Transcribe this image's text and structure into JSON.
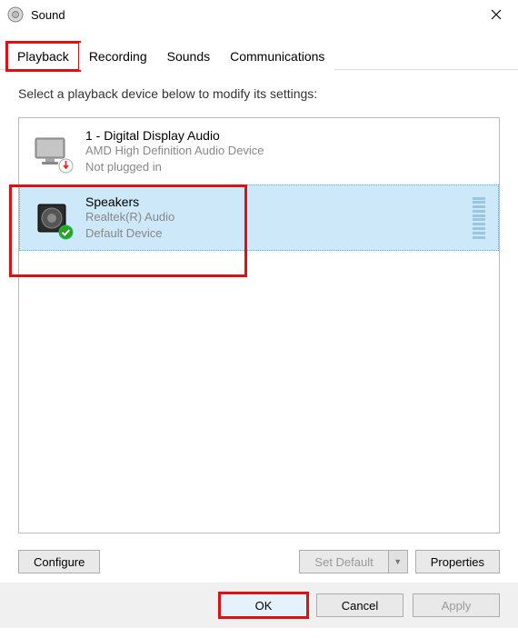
{
  "window": {
    "title": "Sound"
  },
  "tabs": {
    "playback": "Playback",
    "recording": "Recording",
    "sounds": "Sounds",
    "communications": "Communications"
  },
  "instruction": "Select a playback device below to modify its settings:",
  "devices": [
    {
      "name": "1 - Digital Display Audio",
      "driver": "AMD High Definition Audio Device",
      "status": "Not plugged in"
    },
    {
      "name": "Speakers",
      "driver": "Realtek(R) Audio",
      "status": "Default Device"
    }
  ],
  "buttons": {
    "configure": "Configure",
    "set_default": "Set Default",
    "properties": "Properties",
    "ok": "OK",
    "cancel": "Cancel",
    "apply": "Apply"
  }
}
